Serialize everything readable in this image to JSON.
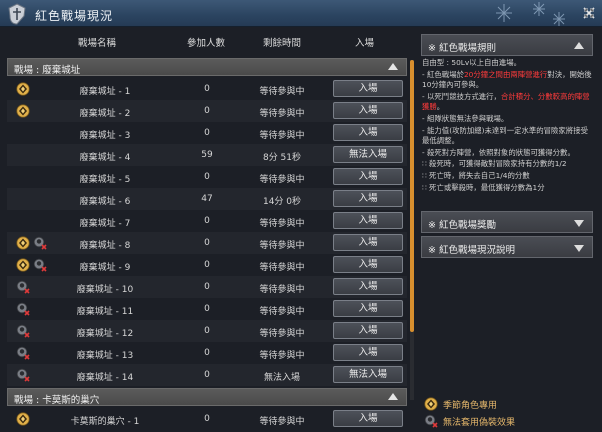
{
  "window": {
    "title": "紅色戰場現況"
  },
  "columns": {
    "name": "戰場名稱",
    "players": "參加人數",
    "time": "剩餘時間",
    "enter": "入場"
  },
  "sections": [
    {
      "label": "戰場 : 廢棄城址"
    },
    {
      "label": "戰場 : 卡莫斯的巢穴"
    }
  ],
  "rows": [
    {
      "icons": [
        "season"
      ],
      "name": "廢棄城址 - 1",
      "players": "0",
      "status": "等待參與中",
      "button": "入場"
    },
    {
      "icons": [
        "season"
      ],
      "name": "廢棄城址 - 2",
      "players": "0",
      "status": "等待參與中",
      "button": "入場"
    },
    {
      "icons": [],
      "name": "廢棄城址 - 3",
      "players": "0",
      "status": "等待參與中",
      "button": "入場"
    },
    {
      "icons": [],
      "name": "廢棄城址 - 4",
      "players": "59",
      "status": "8分 51秒",
      "button": "無法入場"
    },
    {
      "icons": [],
      "name": "廢棄城址 - 5",
      "players": "0",
      "status": "等待參與中",
      "button": "入場"
    },
    {
      "icons": [],
      "name": "廢棄城址 - 6",
      "players": "47",
      "status": "14分 0秒",
      "button": "入場"
    },
    {
      "icons": [],
      "name": "廢棄城址 - 7",
      "players": "0",
      "status": "等待參與中",
      "button": "入場"
    },
    {
      "icons": [
        "season",
        "nocostume"
      ],
      "name": "廢棄城址 - 8",
      "players": "0",
      "status": "等待參與中",
      "button": "入場"
    },
    {
      "icons": [
        "season",
        "nocostume"
      ],
      "name": "廢棄城址 - 9",
      "players": "0",
      "status": "等待參與中",
      "button": "入場"
    },
    {
      "icons": [
        "nocostume"
      ],
      "name": "廢棄城址 - 10",
      "players": "0",
      "status": "等待參與中",
      "button": "入場"
    },
    {
      "icons": [
        "nocostume"
      ],
      "name": "廢棄城址 - 11",
      "players": "0",
      "status": "等待參與中",
      "button": "入場"
    },
    {
      "icons": [
        "nocostume"
      ],
      "name": "廢棄城址 - 12",
      "players": "0",
      "status": "等待參與中",
      "button": "入場"
    },
    {
      "icons": [
        "nocostume"
      ],
      "name": "廢棄城址 - 13",
      "players": "0",
      "status": "等待參與中",
      "button": "入場"
    },
    {
      "icons": [
        "nocostume"
      ],
      "name": "廢棄城址 - 14",
      "players": "0",
      "status": "無法入場",
      "button": "無法入場"
    },
    {
      "icons": [
        "season"
      ],
      "name": "卡莫斯的巢穴 - 1",
      "players": "0",
      "status": "等待參與中",
      "button": "入場"
    }
  ],
  "right_panel": {
    "rules_title": "※ 紅色戰場規則",
    "rules": {
      "line1": "自由型 : 50Lv以上自由進場。",
      "line2a": "- 紅色戰場於",
      "line2b": "20分鐘之間由兩陣營進行",
      "line2c": "對決，開始後10分鐘內可參與。",
      "line3a": "- 以死鬥競技方式進行，",
      "line3b": "合計積分、分數較高的陣營獲勝",
      "line3c": "。",
      "line4": "- 組隊狀態無法參與戰場。",
      "line5": "- 能力值(攻防加總)未達到一定水準的冒險家將接受最低調整。",
      "line6": "- 殺死對方陣營，依照對象的狀態可獲得分數。",
      "line7": "∷ 殺死時，可獲得敵對冒險家持有分數的1/2",
      "line8": "∷ 死亡時，將失去自己1/4的分數",
      "line9": "∷ 死亡或擊殺時，最低獲得分數為1分"
    },
    "reward_title": "※ 紅色戰場獎勵",
    "status_title": "※ 紅色戰場現況說明",
    "legend": [
      {
        "icon": "season",
        "label": "季節角色專用"
      },
      {
        "icon": "nocostume",
        "label": "無法套用偽裝效果"
      }
    ]
  },
  "colors": {
    "highlight": "#ff3b3b",
    "scroll_thumb": "#d88f2e",
    "legend_text": "#e2b56a"
  }
}
